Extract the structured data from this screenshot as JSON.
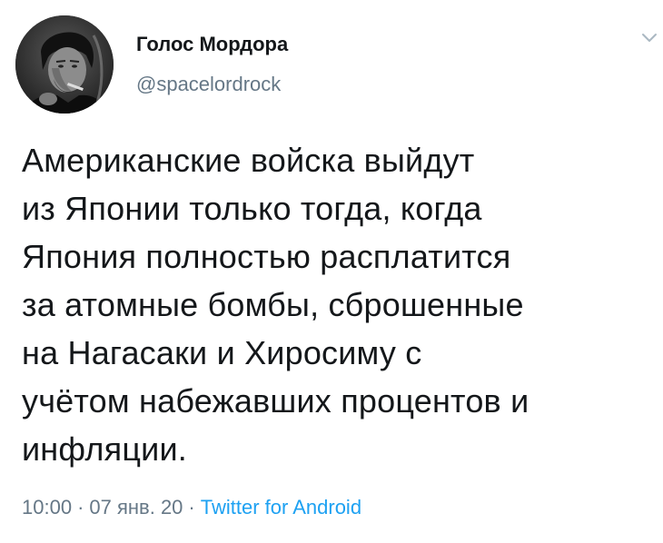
{
  "author": {
    "display_name": "Голос Мордора",
    "handle": "@spacelordrock"
  },
  "icons": {
    "avatar": "profile-avatar",
    "menu": "chevron-down-icon"
  },
  "tweet": {
    "text": "Американские войска выйдут\nиз Японии только тогда, когда\nЯпония полностью расплатится\nза атомные бомбы, сброшенные\nна Нагасаки и Хиросиму с\nучётом набежавших процентов и\nинфляции."
  },
  "meta": {
    "time": "10:00",
    "date": "07 янв. 20",
    "separator": "·",
    "source": "Twitter for Android"
  },
  "colors": {
    "text": "#14171a",
    "secondary": "#657786",
    "link": "#1da1f2"
  }
}
